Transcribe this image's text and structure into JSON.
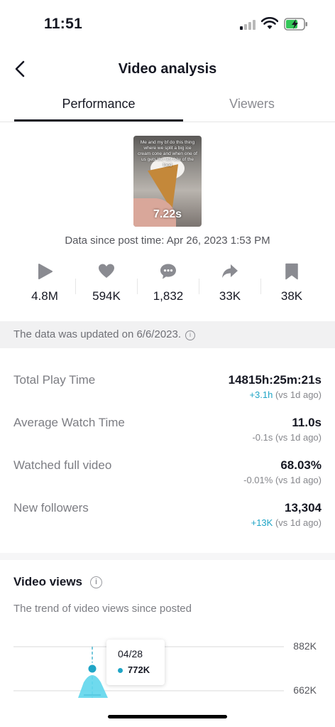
{
  "status_bar": {
    "time": "11:51"
  },
  "nav": {
    "title": "Video analysis"
  },
  "tabs": [
    {
      "label": "Performance",
      "active": true
    },
    {
      "label": "Viewers",
      "active": false
    }
  ],
  "video": {
    "duration": "7.22s",
    "caption": "Me and my bf do this thing where we split a big ice cream cone and when one of us gets the last bite of the food"
  },
  "since_text": "Data since post time: Apr 26, 2023 1:53 PM",
  "stats": [
    {
      "icon": "play-icon",
      "value": "4.8M"
    },
    {
      "icon": "heart-icon",
      "value": "594K"
    },
    {
      "icon": "comment-icon",
      "value": "1,832"
    },
    {
      "icon": "share-icon",
      "value": "33K"
    },
    {
      "icon": "bookmark-icon",
      "value": "38K"
    }
  ],
  "update_notice": "The data was updated on 6/6/2023.",
  "metrics": [
    {
      "label": "Total Play Time",
      "value": "14815h:25m:21s",
      "delta": "+3.1h",
      "delta_suffix": " (vs 1d ago)",
      "positive": true
    },
    {
      "label": "Average Watch Time",
      "value": "11.0s",
      "delta": "-0.1s",
      "delta_suffix": " (vs 1d ago)",
      "positive": false
    },
    {
      "label": "Watched full video",
      "value": "68.03%",
      "delta": "-0.01%",
      "delta_suffix": " (vs 1d ago)",
      "positive": false
    },
    {
      "label": "New followers",
      "value": "13,304",
      "delta": "+13K",
      "delta_suffix": " (vs 1d ago)",
      "positive": true
    }
  ],
  "video_views": {
    "title": "Video views",
    "subtitle": "The trend of video views since posted",
    "tooltip": {
      "date": "04/28",
      "value": "772K"
    }
  },
  "chart_data": {
    "type": "area",
    "y_ticks": [
      "882K",
      "662K"
    ],
    "points": [
      {
        "x": "04/28",
        "y": 772000
      }
    ],
    "colors": {
      "series": "#20a5c6",
      "fill": "#5fd6ec"
    }
  },
  "colors": {
    "accent": "#20a5c6",
    "text": "#161823",
    "muted": "#7c7d83"
  }
}
